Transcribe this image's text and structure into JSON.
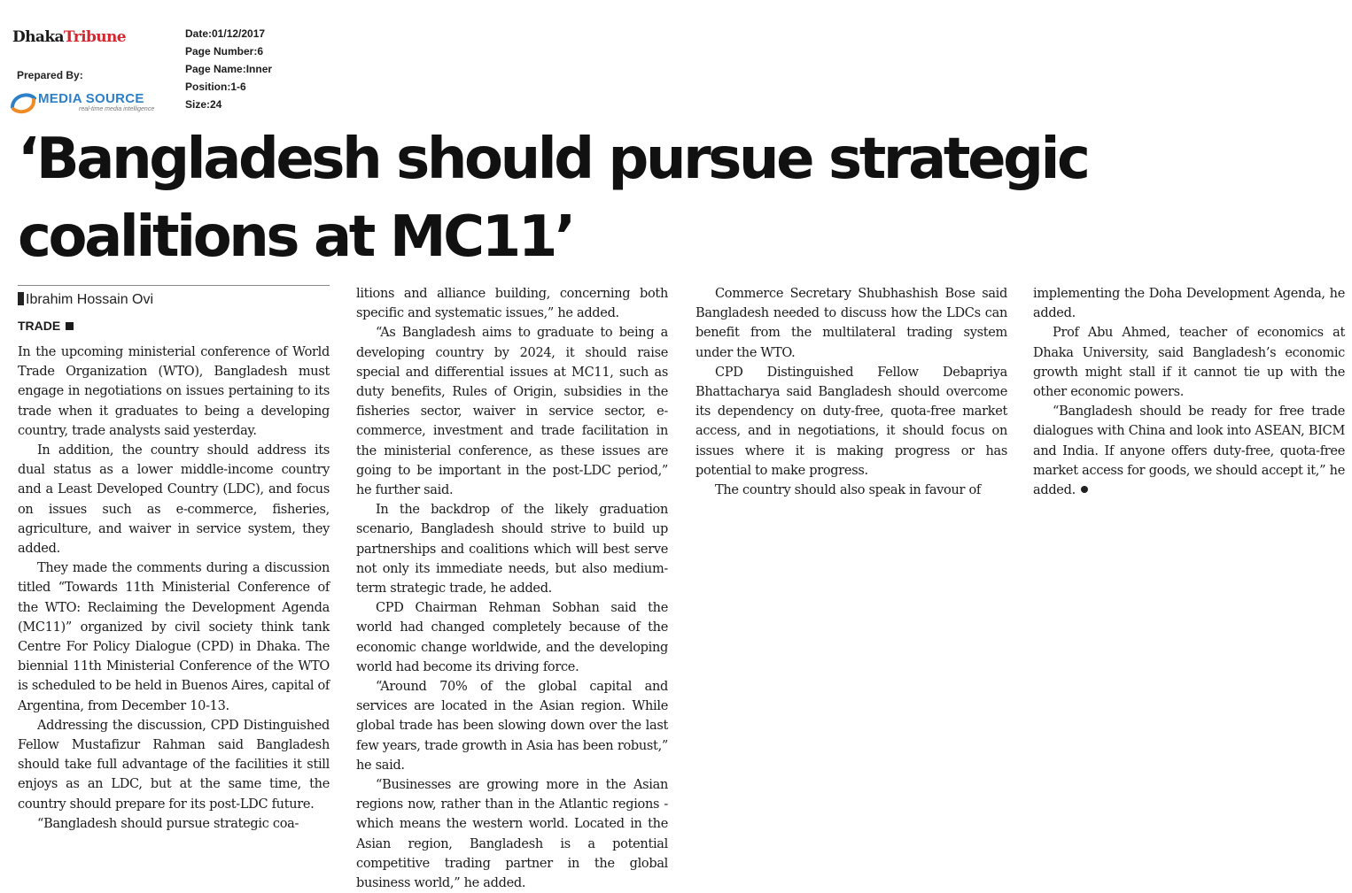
{
  "masthead": {
    "logo_part1": "Dhaka",
    "logo_part2": "Tribune",
    "prepared_by": "Prepared By:",
    "media_source_name": "MEDIA SOURCE",
    "media_source_tagline": "real-time media intelligence"
  },
  "meta": {
    "date": "Date:01/12/2017",
    "page_number": "Page Number:6",
    "page_name": "Page Name:Inner",
    "position": "Position:1-6",
    "size": "Size:24"
  },
  "colors": {
    "logo_red": "#d7262f",
    "media_source_blue": "#2d7fc7",
    "text": "#1a1a1a"
  },
  "article": {
    "headline_line1": "‘Bangladesh should pursue strategic",
    "headline_line2": "coalitions at MC11’",
    "byline": "Ibrahim Hossain Ovi",
    "section": "TRADE",
    "col1": [
      "In the upcoming ministerial conference of World Trade Organization (WTO), Bangladesh must engage in negotiations on issues pertaining to its trade when it graduates to being a developing country, trade analysts said yesterday.",
      "In addition, the country should address its dual status as a lower middle-income country and a Least Developed Country (LDC), and focus on issues such as e-commerce, fisheries, agriculture, and waiver in service system, they added.",
      "They made the comments during a discussion titled “Towards 11th Ministerial Conference of the WTO: Reclaiming the Development Agenda (MC11)” organized by civil society think tank Centre For Policy Dialogue (CPD) in Dhaka. The biennial 11th Ministerial Conference of the WTO is scheduled to be held in Buenos Aires, capital of Argentina, from December 10-13.",
      "Addressing the discussion, CPD Distinguished Fellow Mustafizur Rahman said Bangladesh should take full advantage of the facilities it still enjoys as an LDC, but at the same time, the country should prepare for its post-LDC future.",
      "“Bangladesh should pursue strategic coa-"
    ],
    "col2": [
      "litions and alliance building, concerning both specific and systematic issues,” he added.",
      "“As Bangladesh aims to graduate to being a developing country by 2024, it should raise special and differential issues at MC11, such as duty benefits, Rules of Origin, subsidies in the fisheries sector, waiver in service sector, e-commerce, investment and trade facilitation in the ministerial conference, as these issues are going to be important in the post-LDC period,” he further said.",
      "In the backdrop of the likely graduation scenario, Bangladesh should strive to build up partnerships and coalitions which will best serve not only its immediate needs, but also medium-term strategic trade, he added.",
      "CPD Chairman Rehman Sobhan said the world had changed completely because of the economic change worldwide, and the developing world had become its driving force.",
      "“Around 70% of the global capital and services are located in the Asian region. While global trade has been slowing down over the last few years, trade growth in Asia has been robust,” he said.",
      "“Businesses are growing more in the Asian regions now, rather than in the Atlantic regions - which means the western world. Located in the Asian region, Bangladesh is a potential competitive trading partner in the global business world,” he added."
    ],
    "col3": [
      "Commerce Secretary Shubhashish Bose said Bangladesh needed to discuss how the LDCs can benefit from the multilateral trading system under the WTO.",
      "CPD Distinguished Fellow Debapriya Bhattacharya said Bangladesh should overcome its dependency on duty-free, quota-free market access, and in negotiations, it should focus on issues where it is making progress or has potential to make progress.",
      "The country should also speak in favour of"
    ],
    "col4": [
      "implementing the Doha Development Agenda, he added.",
      "Prof Abu Ahmed, teacher of economics at Dhaka University, said Bangladesh’s economic growth might stall if it cannot tie up with the other economic powers.",
      "“Bangladesh should be ready for free trade dialogues with China and look into ASEAN, BICM and India. If anyone offers duty-free, quota-free market access for goods, we should accept it,” he added."
    ]
  }
}
